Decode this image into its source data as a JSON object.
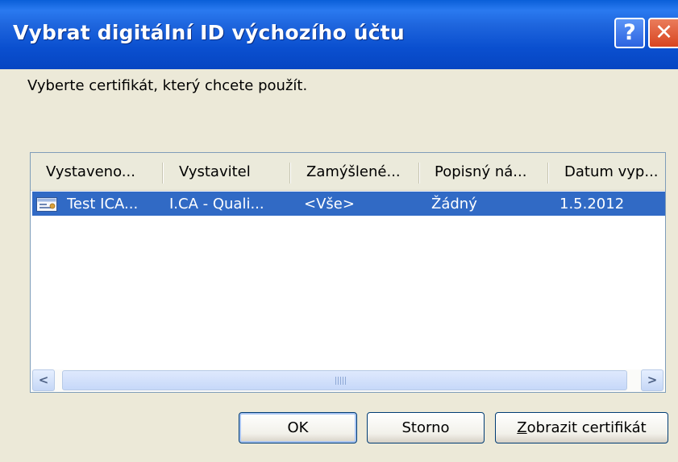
{
  "window": {
    "title": "Vybrat digitální ID výchozího účtu",
    "help_glyph": "?",
    "close_glyph": "✕"
  },
  "prompt": "Vyberte certifikát, který chcete použít.",
  "list": {
    "columns": [
      "Vystaveno...",
      "Vystavitel",
      "Zamýšlené...",
      "Popisný ná...",
      "Datum vyp..."
    ],
    "rows": [
      {
        "issued_to": "Test ICA...",
        "issuer": "I.CA - Quali...",
        "purpose": "<Vše>",
        "friendly_name": "Žádný",
        "expiry": "1.5.2012",
        "icon": "certificate-icon",
        "selected": true
      }
    ],
    "selection_color": "#316ac5"
  },
  "scrollbar": {
    "left_arrow": "<",
    "right_arrow": ">"
  },
  "buttons": {
    "ok": "OK",
    "cancel": "Storno",
    "view_mnemonic": "Z",
    "view_rest": "obrazit certifikát"
  }
}
